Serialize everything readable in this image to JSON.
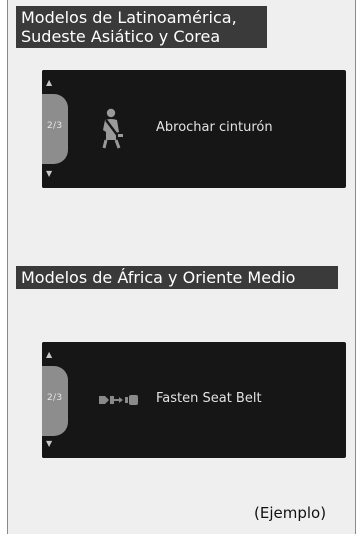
{
  "sections": [
    {
      "header": "Modelos de Latinoamérica,\nSudeste Asiático y Corea",
      "display": {
        "page_indicator": "2/3",
        "icon": "seatbelt-reminder-icon",
        "message": "Abrochar cinturón"
      }
    },
    {
      "header": "Modelos de África y Oriente Medio",
      "display": {
        "page_indicator": "2/3",
        "icon": "seatbelt-pretensioner-icon",
        "message": "Fasten Seat Belt"
      }
    }
  ],
  "caption": "(Ejemplo)",
  "colors": {
    "header_bg": "#3a3a3a",
    "panel_bg": "#efefef",
    "display_bg": "#161616",
    "display_text": "#e2e2e2",
    "pager_tab": "#8d8d8d"
  }
}
